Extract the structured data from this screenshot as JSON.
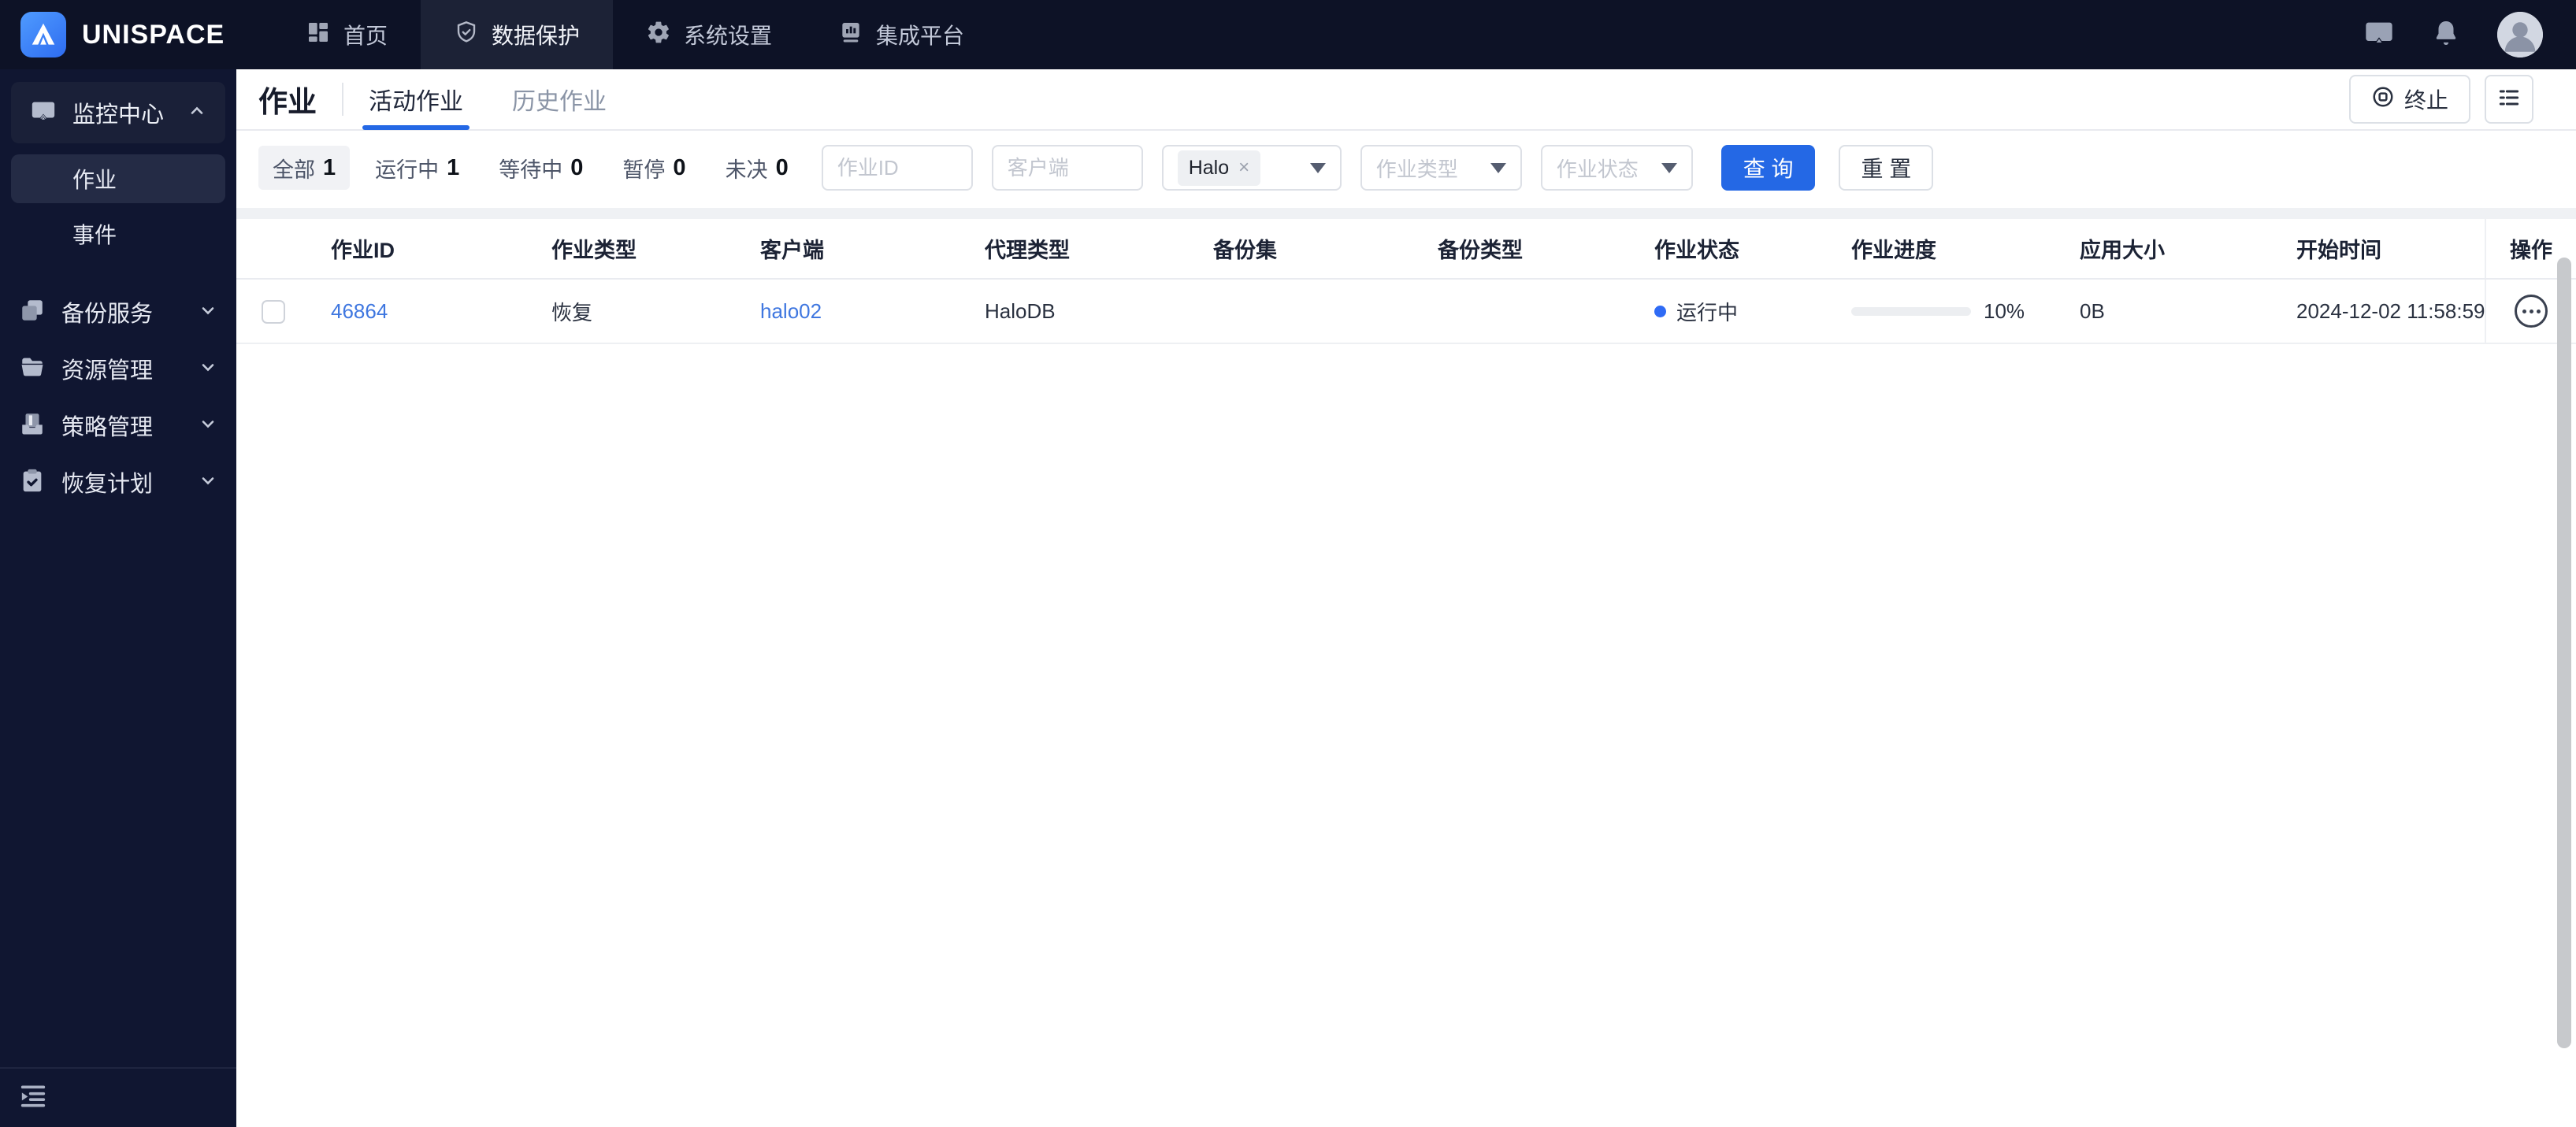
{
  "brand": {
    "name": "UNISPACE",
    "logo_icon": "unispace-mountain-icon"
  },
  "topnav": {
    "items": [
      {
        "label": "首页",
        "icon": "dashboard-icon",
        "active": false
      },
      {
        "label": "数据保护",
        "icon": "shield-check-icon",
        "active": true
      },
      {
        "label": "系统设置",
        "icon": "gear-icon",
        "active": false
      },
      {
        "label": "集成平台",
        "icon": "bar-chart-icon",
        "active": false
      }
    ],
    "right_icons": [
      "screen-share-icon",
      "bell-icon",
      "avatar"
    ]
  },
  "sidebar": {
    "monitor_group": {
      "label": "监控中心",
      "icon": "monitor-cast-icon",
      "expanded": true,
      "children": [
        {
          "label": "作业",
          "active": true
        },
        {
          "label": "事件",
          "active": false
        }
      ]
    },
    "groups": [
      {
        "label": "备份服务",
        "icon": "copy-pages-icon"
      },
      {
        "label": "资源管理",
        "icon": "folder-icon"
      },
      {
        "label": "策略管理",
        "icon": "tray-icon"
      },
      {
        "label": "恢复计划",
        "icon": "clipboard-check-icon"
      }
    ]
  },
  "page": {
    "title": "作业",
    "tabs": [
      {
        "label": "活动作业",
        "active": true
      },
      {
        "label": "历史作业",
        "active": false
      }
    ],
    "terminate_label": "终止"
  },
  "filters": {
    "chips": [
      {
        "label": "全部",
        "count": "1",
        "active": true
      },
      {
        "label": "运行中",
        "count": "1",
        "active": false
      },
      {
        "label": "等待中",
        "count": "0",
        "active": false
      },
      {
        "label": "暂停",
        "count": "0",
        "active": false
      },
      {
        "label": "未决",
        "count": "0",
        "active": false
      }
    ],
    "job_id_placeholder": "作业ID",
    "client_placeholder": "客户端",
    "agent_tag": "Halo",
    "agent_tag_close": "×",
    "job_type_placeholder": "作业类型",
    "job_status_placeholder": "作业状态",
    "query_label": "查 询",
    "reset_label": "重 置"
  },
  "table": {
    "columns": [
      "作业ID",
      "作业类型",
      "客户端",
      "代理类型",
      "备份集",
      "备份类型",
      "作业状态",
      "作业进度",
      "应用大小",
      "开始时间",
      "操作"
    ],
    "row": {
      "job_id": "46864",
      "job_type": "恢复",
      "client": "halo02",
      "agent_type": "HaloDB",
      "backup_set": "",
      "backup_type": "",
      "status_label": "运行中",
      "progress_pct": 10,
      "progress_label": "10%",
      "app_size": "0B",
      "start_time": "2024-12-02 11:58:59"
    }
  },
  "colors": {
    "accent": "#2468e5",
    "link": "#3f77e0",
    "status_dot": "#2f6bf5",
    "topbar_bg": "#0d1226",
    "sidebar_bg": "#101631"
  }
}
